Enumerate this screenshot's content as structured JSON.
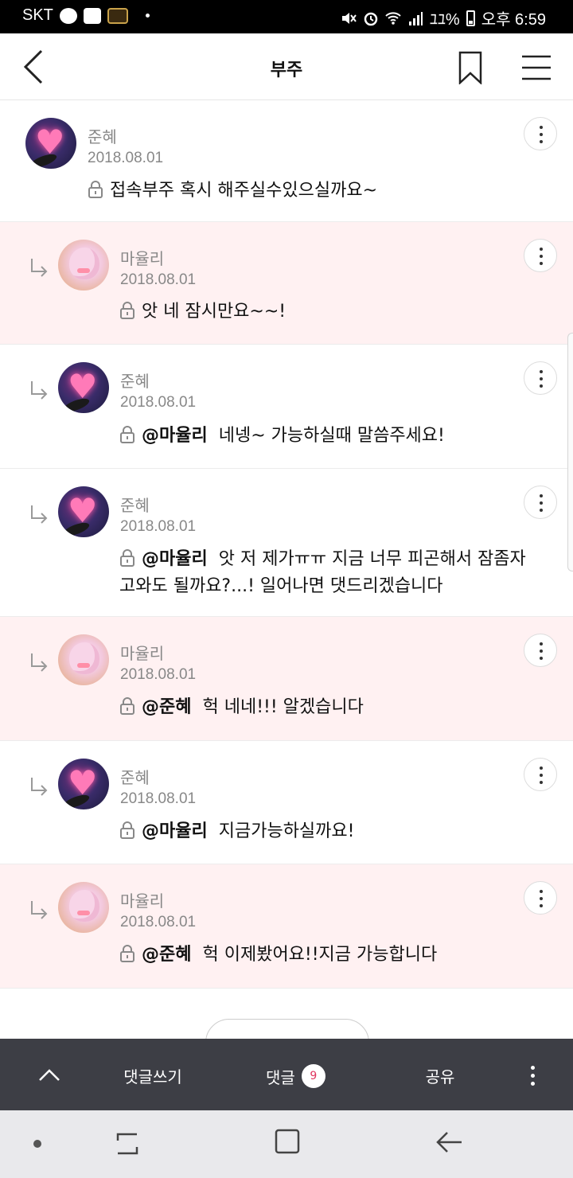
{
  "status_bar": {
    "carrier": "SKT",
    "battery": "ﾕﾕ%",
    "time": "오후 6:59",
    "icons": [
      "talk-icon",
      "image-icon",
      "game-icon",
      "mute-icon",
      "alarm-icon",
      "wifi-icon",
      "signal-icon",
      "battery-icon"
    ]
  },
  "header": {
    "title": "부주",
    "icons": [
      "back-arrow-icon",
      "bookmark-icon",
      "hamburger-menu-icon"
    ]
  },
  "comments": [
    {
      "author": "준혜",
      "date": "2018.08.01",
      "mention": "",
      "text": "접속부주 혹시 해주실수있으실까요~",
      "text2": "",
      "is_reply": false,
      "highlighted": false,
      "avatar": "junhye"
    },
    {
      "author": "마율리",
      "date": "2018.08.01",
      "mention": "",
      "text": "앗 네 잠시만요~~!",
      "text2": "",
      "is_reply": true,
      "highlighted": true,
      "avatar": "mayulri"
    },
    {
      "author": "준혜",
      "date": "2018.08.01",
      "mention": "@마율리",
      "text": "네넹~ 가능하실때 말씀주세요!",
      "text2": "",
      "is_reply": true,
      "highlighted": false,
      "avatar": "junhye"
    },
    {
      "author": "준혜",
      "date": "2018.08.01",
      "mention": "@마율리",
      "text": "앗 저 제가ㅠㅠ 지금 너무 피곤해서 잠좀자",
      "text2": "고와도 될까요?...! 일어나면 댓드리겠습니다",
      "is_reply": true,
      "highlighted": false,
      "avatar": "junhye"
    },
    {
      "author": "마율리",
      "date": "2018.08.01",
      "mention": "@준혜",
      "text": "헉 네네!!! 알겠습니다",
      "text2": "",
      "is_reply": true,
      "highlighted": true,
      "avatar": "mayulri"
    },
    {
      "author": "준혜",
      "date": "2018.08.01",
      "mention": "@마율리",
      "text": "지금가능하실까요!",
      "text2": "",
      "is_reply": true,
      "highlighted": false,
      "avatar": "junhye"
    },
    {
      "author": "마율리",
      "date": "2018.08.01",
      "mention": "@준혜",
      "text": "헉 이제봤어요!!지금 가능합니다",
      "text2": "",
      "is_reply": true,
      "highlighted": true,
      "avatar": "mayulri"
    }
  ],
  "bottom_bar": {
    "write_label": "댓글쓰기",
    "comments_label": "댓글",
    "comment_count": "9",
    "share_label": "공유"
  },
  "colors": {
    "highlight_bg": "#fff1f2",
    "bottom_bar_bg": "#3d3e45",
    "count_badge_text": "#e0355e"
  }
}
